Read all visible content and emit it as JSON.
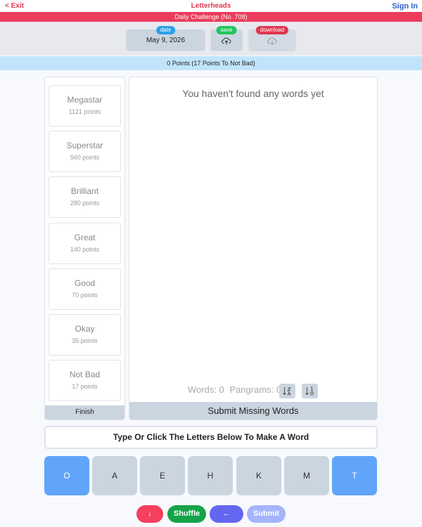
{
  "header": {
    "exit_label": "< Exit",
    "title": "Letterheads",
    "signin_label": "Sign In"
  },
  "challenge": {
    "label": "Daily Challenge (No. 708)"
  },
  "controls": {
    "date_pill": "date",
    "date_value": "May 9, 2026",
    "save_pill": "save",
    "download_pill": "download"
  },
  "score": {
    "status": "0 Points (17 Points To Not Bad)"
  },
  "levels": [
    {
      "name": "Megastar",
      "points": "1121 points"
    },
    {
      "name": "Superstar",
      "points": "560 points"
    },
    {
      "name": "Brilliant",
      "points": "280 points"
    },
    {
      "name": "Great",
      "points": "140 points"
    },
    {
      "name": "Good",
      "points": "70 points"
    },
    {
      "name": "Okay",
      "points": "35 points"
    },
    {
      "name": "Not Bad",
      "points": "17 points"
    }
  ],
  "finish_label": "Finish",
  "words_panel": {
    "empty_message": "You haven't found any words yet",
    "words_count": "Words: 0",
    "pangrams_count": "Pangrams: 0",
    "submit_missing_label": "Submit Missing Words"
  },
  "input": {
    "prompt": "Type Or Click The Letters Below To Make A Word"
  },
  "letters": [
    "O",
    "A",
    "E",
    "H",
    "K",
    "M",
    "T"
  ],
  "buttons": {
    "delete_label": "↓",
    "shuffle_label": "Shuffle",
    "back_label": "←",
    "submit_label": "Submit"
  },
  "colors": {
    "brand_red": "#ec3d5c",
    "center_letter": "#60a5fa",
    "tile": "#cbd5e0",
    "points_bar": "#c2e4fb"
  }
}
